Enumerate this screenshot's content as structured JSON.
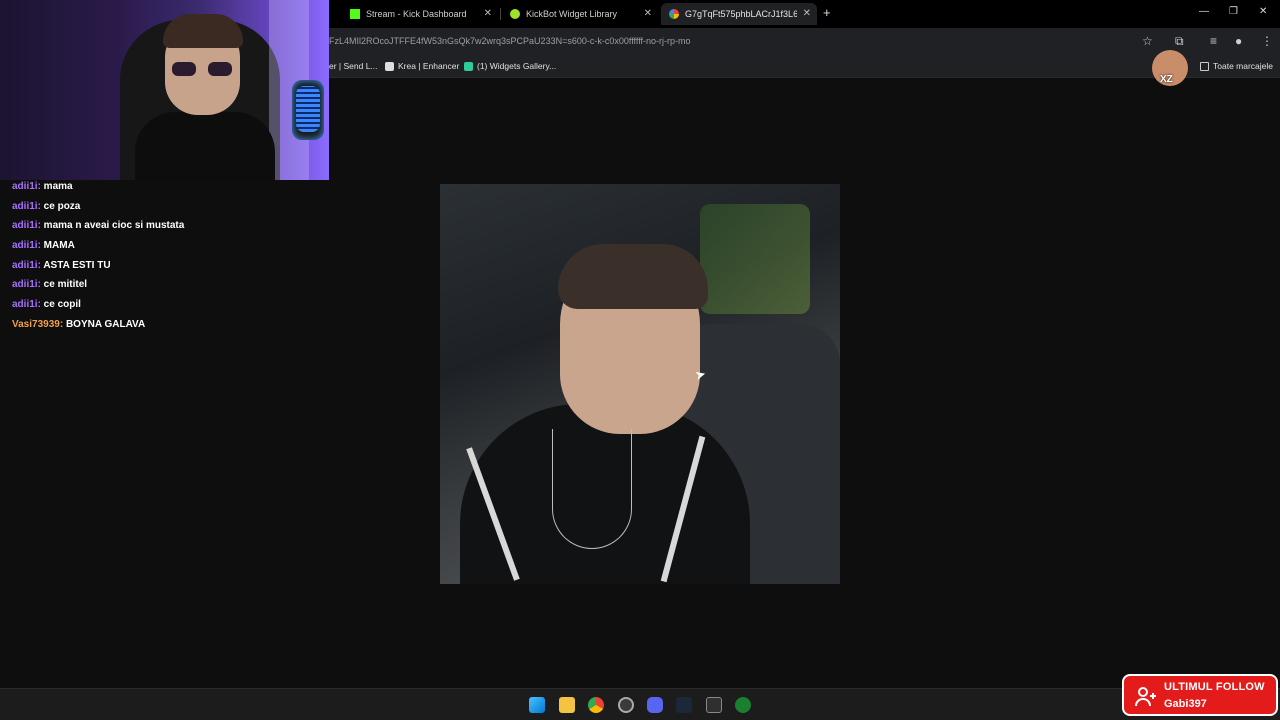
{
  "browser": {
    "tabs": [
      {
        "label": "Stream - Kick Dashboard",
        "icon": "kick-icon",
        "color": "#53fc18"
      },
      {
        "label": "KickBot Widget Library",
        "icon": "kickbot-icon",
        "color": "#9fe22b"
      },
      {
        "label": "G7gTqFt575phbLACrJ1f3L6odc",
        "icon": "google-photos-icon",
        "color": "#fbbc05",
        "active": true
      }
    ],
    "new_tab": "+",
    "url": "FzL4MIl2ROcoJTFFE4fW53nGsQk7w2wrq3sPCPaU233N=s600-c-k-c0x00ffffff-no-rj-rp-mo",
    "bookmarks": [
      {
        "label": "er | Send L...",
        "icon": "send-icon"
      },
      {
        "label": "Krea | Enhancer",
        "icon": "krea-icon"
      },
      {
        "label": "(1) Widgets Gallery...",
        "icon": "widgets-icon"
      }
    ],
    "all_bookmarks": "Toate marcajele"
  },
  "chat": [
    {
      "user": "adii1i:",
      "text": " mama",
      "color": "#a970ff"
    },
    {
      "user": "adii1i:",
      "text": " ce poza",
      "color": "#a970ff"
    },
    {
      "user": "adii1i:",
      "text": " mama n aveai cioc si mustata",
      "color": "#a970ff"
    },
    {
      "user": "adii1i:",
      "text": " MAMA",
      "color": "#a970ff"
    },
    {
      "user": "adii1i:",
      "text": " ASTA ESTI TU",
      "color": "#a970ff"
    },
    {
      "user": "adii1i:",
      "text": " ce mititel",
      "color": "#a970ff"
    },
    {
      "user": "adii1i:",
      "text": " ce copil",
      "color": "#a970ff"
    },
    {
      "user": "Vasi73939:",
      "text": " BOYNA GALAVA",
      "color": "#f0a050"
    }
  ],
  "follow_alert": {
    "title": "ULTIMUL FOLLOW",
    "name": "Gabi397",
    "bg": "#e31b1b"
  },
  "avatar_badge": "XZ"
}
